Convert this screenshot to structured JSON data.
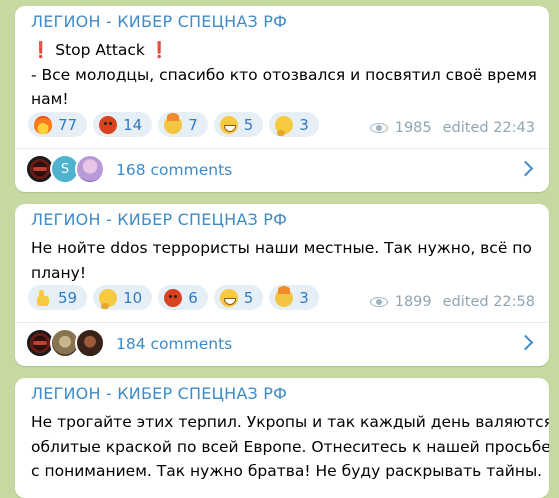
{
  "posts": [
    {
      "sender": "ЛЕГИОН - КИБЕР СПЕЦНАЗ РФ",
      "lines": [
        "Stop Attack",
        "- Все молодцы, спасибо кто отозвался и посвятил своё время",
        "нам!"
      ],
      "excl": "❗",
      "reactions": [
        {
          "icon": "fire-icon",
          "count": "77"
        },
        {
          "icon": "angry-face-icon",
          "count": "14"
        },
        {
          "icon": "exploding-head-icon",
          "count": "7"
        },
        {
          "icon": "grin-face-icon",
          "count": "5"
        },
        {
          "icon": "thinking-face-icon",
          "count": "3"
        }
      ],
      "views": "1985",
      "edited": "edited 22:43",
      "comments": "168 comments"
    },
    {
      "sender": "ЛЕГИОН - КИБЕР СПЕЦНАЗ РФ",
      "lines": [
        "Не нойте ddos террористы наши местные. Так нужно, всё по",
        "плану!"
      ],
      "reactions": [
        {
          "icon": "thumbs-up-icon",
          "count": "59"
        },
        {
          "icon": "thinking-face-icon",
          "count": "10"
        },
        {
          "icon": "angry-face-icon",
          "count": "6"
        },
        {
          "icon": "grin-face-icon",
          "count": "5"
        },
        {
          "icon": "exploding-head-icon",
          "count": "3"
        }
      ],
      "views": "1899",
      "edited": "edited 22:58",
      "comments": "184 comments"
    },
    {
      "sender": "ЛЕГИОН - КИБЕР СПЕЦНАЗ РФ",
      "lines": [
        "Не трогайте этих терпил. Укропы и так каждый день валяются",
        "облитые краской по всей Европе. Отнеситесь к нашей просьбе",
        "с пониманием. Так нужно братва! Не буду раскрывать тайны."
      ]
    }
  ]
}
